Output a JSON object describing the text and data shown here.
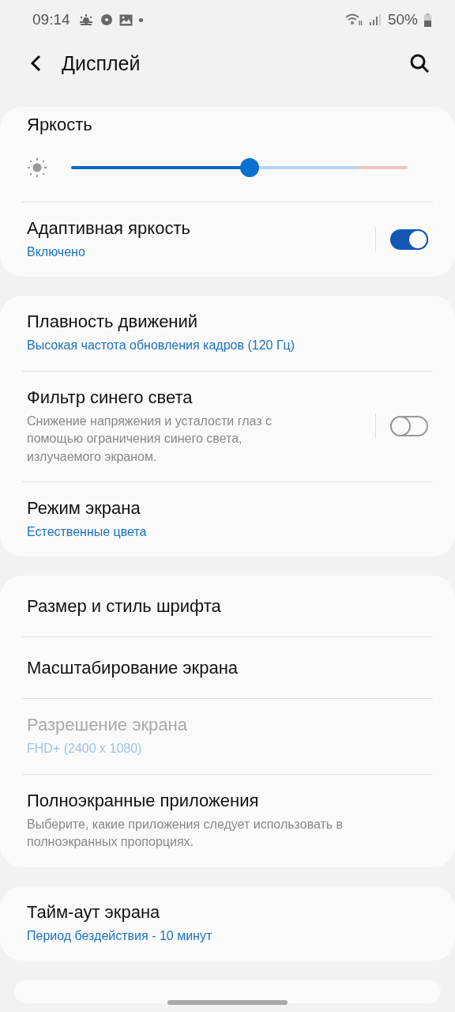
{
  "status_bar": {
    "time": "09:14",
    "battery": "50%"
  },
  "header": {
    "title": "Дисплей"
  },
  "groups": [
    {
      "items": [
        {
          "kind": "slider",
          "title": "Яркость",
          "level": 0.53,
          "disabled": false
        },
        {
          "kind": "switch",
          "title": "Адаптивная яркость",
          "subtitle": "Включено",
          "subtitle_hint": false,
          "on": true,
          "disabled": false
        }
      ]
    },
    {
      "items": [
        {
          "kind": "text",
          "title": "Плавность движений",
          "subtitle": "Высокая частота обновления кадров (120 Гц)",
          "subtitle_hint": false,
          "disabled": false
        },
        {
          "kind": "switch",
          "title": "Фильтр синего света",
          "subtitle": "Снижение напряжения и усталости глаз с помощью ограничения синего света, излучаемого экраном.",
          "subtitle_hint": true,
          "on": false,
          "disabled": false
        },
        {
          "kind": "text",
          "title": "Режим экрана",
          "subtitle": "Естественные цвета",
          "subtitle_hint": false,
          "disabled": false
        }
      ]
    },
    {
      "items": [
        {
          "kind": "text",
          "title": "Размер и стиль шрифта",
          "disabled": false
        },
        {
          "kind": "text",
          "title": "Масштабирование экрана",
          "disabled": false
        },
        {
          "kind": "text",
          "title": "Разрешение экрана",
          "subtitle": "FHD+ (2400 x 1080)",
          "subtitle_hint": false,
          "disabled": true
        },
        {
          "kind": "text",
          "title": "Полноэкранные приложения",
          "subtitle": "Выберите, какие приложения следует использовать в полноэкранных пропорциях.",
          "subtitle_hint": true,
          "disabled": false
        }
      ]
    },
    {
      "items": [
        {
          "kind": "text",
          "title": "Тайм-аут экрана",
          "subtitle": "Период бездействия - 10 минут",
          "subtitle_hint": false,
          "disabled": false
        }
      ]
    }
  ]
}
